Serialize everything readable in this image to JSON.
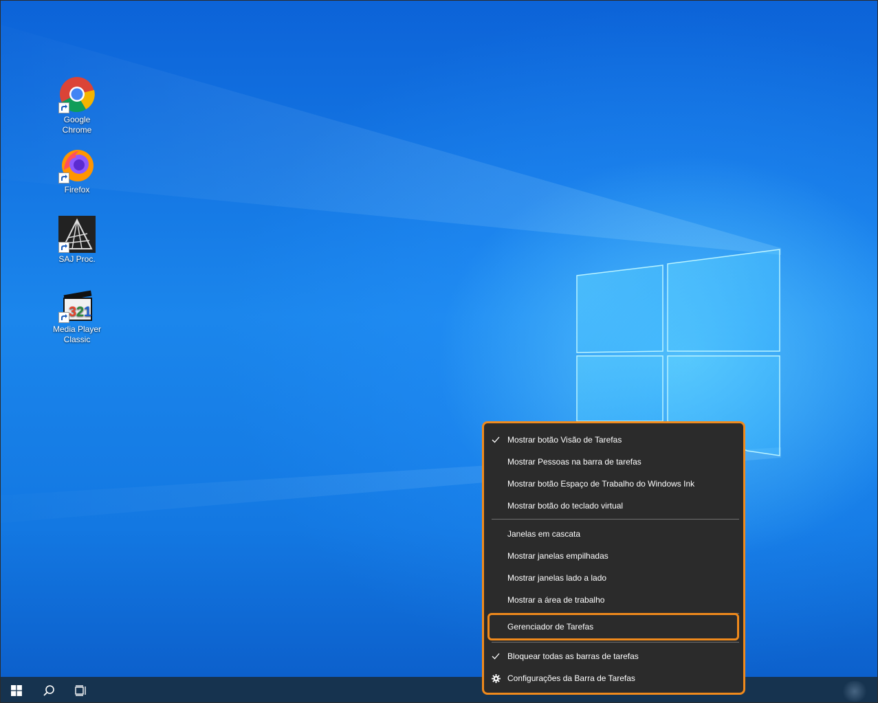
{
  "desktop": {
    "icons": [
      {
        "label_line1": "Google",
        "label_line2": "Chrome",
        "icon": "chrome-icon"
      },
      {
        "label_line1": "Firefox",
        "label_line2": "",
        "icon": "firefox-icon"
      },
      {
        "label_line1": "SAJ Proc.",
        "label_line2": "",
        "icon": "saj-proc-icon"
      },
      {
        "label_line1": "Media Player",
        "label_line2": "Classic",
        "icon": "media-player-classic-icon"
      }
    ]
  },
  "context_menu": {
    "items": [
      {
        "label": "Mostrar botão Visão de Tarefas",
        "checked": true
      },
      {
        "label": "Mostrar Pessoas na barra de tarefas",
        "checked": false
      },
      {
        "label": "Mostrar botão Espaço de Trabalho do Windows Ink",
        "checked": false
      },
      {
        "label": "Mostrar botão do teclado virtual",
        "checked": false
      },
      {
        "label": "Janelas em cascata",
        "checked": false
      },
      {
        "label": "Mostrar janelas empilhadas",
        "checked": false
      },
      {
        "label": "Mostrar janelas lado a lado",
        "checked": false
      },
      {
        "label": "Mostrar a área de trabalho",
        "checked": false
      },
      {
        "label": "Gerenciador de Tarefas",
        "checked": false
      },
      {
        "label": "Bloquear todas as barras de tarefas",
        "checked": true
      },
      {
        "label": "Configurações da Barra de Tarefas",
        "icon": "gear-icon"
      }
    ]
  },
  "taskbar": {
    "buttons": [
      "start-icon",
      "search-icon",
      "task-view-icon"
    ]
  },
  "colors": {
    "highlight": "#f08a1c",
    "menu_bg": "#2b2b2b",
    "taskbar_bg": "#16334f"
  }
}
